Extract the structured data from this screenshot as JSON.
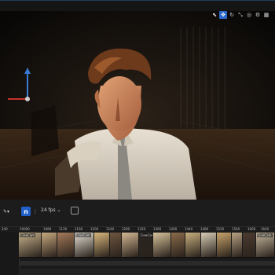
{
  "viewport": {
    "toolbar_icons": [
      "select-icon",
      "move-icon",
      "rotate-icon",
      "scale-icon",
      "camera-icon",
      "settings-icon",
      "grid-icon"
    ]
  },
  "sequencer": {
    "logo_letter": "n",
    "fps_label": "24 fps",
    "ruler_ticks": [
      "240",
      "10000",
      "1080",
      "1120",
      "1160",
      "1200",
      "1240",
      "1280",
      "1320",
      "1360",
      "1400",
      "1440",
      "1480",
      "1520",
      "1560",
      "1600",
      "1640",
      "1680",
      "1720",
      "1740"
    ],
    "thumbnails": [
      {
        "label": "CineCam",
        "color": "#c9b48d"
      },
      {
        "label": "",
        "color": "#c8a97f"
      },
      {
        "label": "",
        "color": "#a47a5a"
      },
      {
        "label": "CineCam",
        "color": "#e8e2d6"
      },
      {
        "label": "",
        "color": "#d8b77c"
      },
      {
        "label": "",
        "color": "#6f5640"
      },
      {
        "label": "",
        "color": "#d4b894"
      },
      {
        "label": "CineCam",
        "color": "#2b2622"
      },
      {
        "label": "",
        "color": "#d6c29a"
      },
      {
        "label": "",
        "color": "#8a6b4a"
      },
      {
        "label": "",
        "color": "#c9b07f"
      },
      {
        "label": "",
        "color": "#d7ccb6"
      },
      {
        "label": "",
        "color": "#c8a46b"
      },
      {
        "label": "",
        "color": "#b7a283"
      },
      {
        "label": "",
        "color": "#4b3b30"
      },
      {
        "label": "CineCam",
        "color": "#c6b79e"
      }
    ]
  }
}
